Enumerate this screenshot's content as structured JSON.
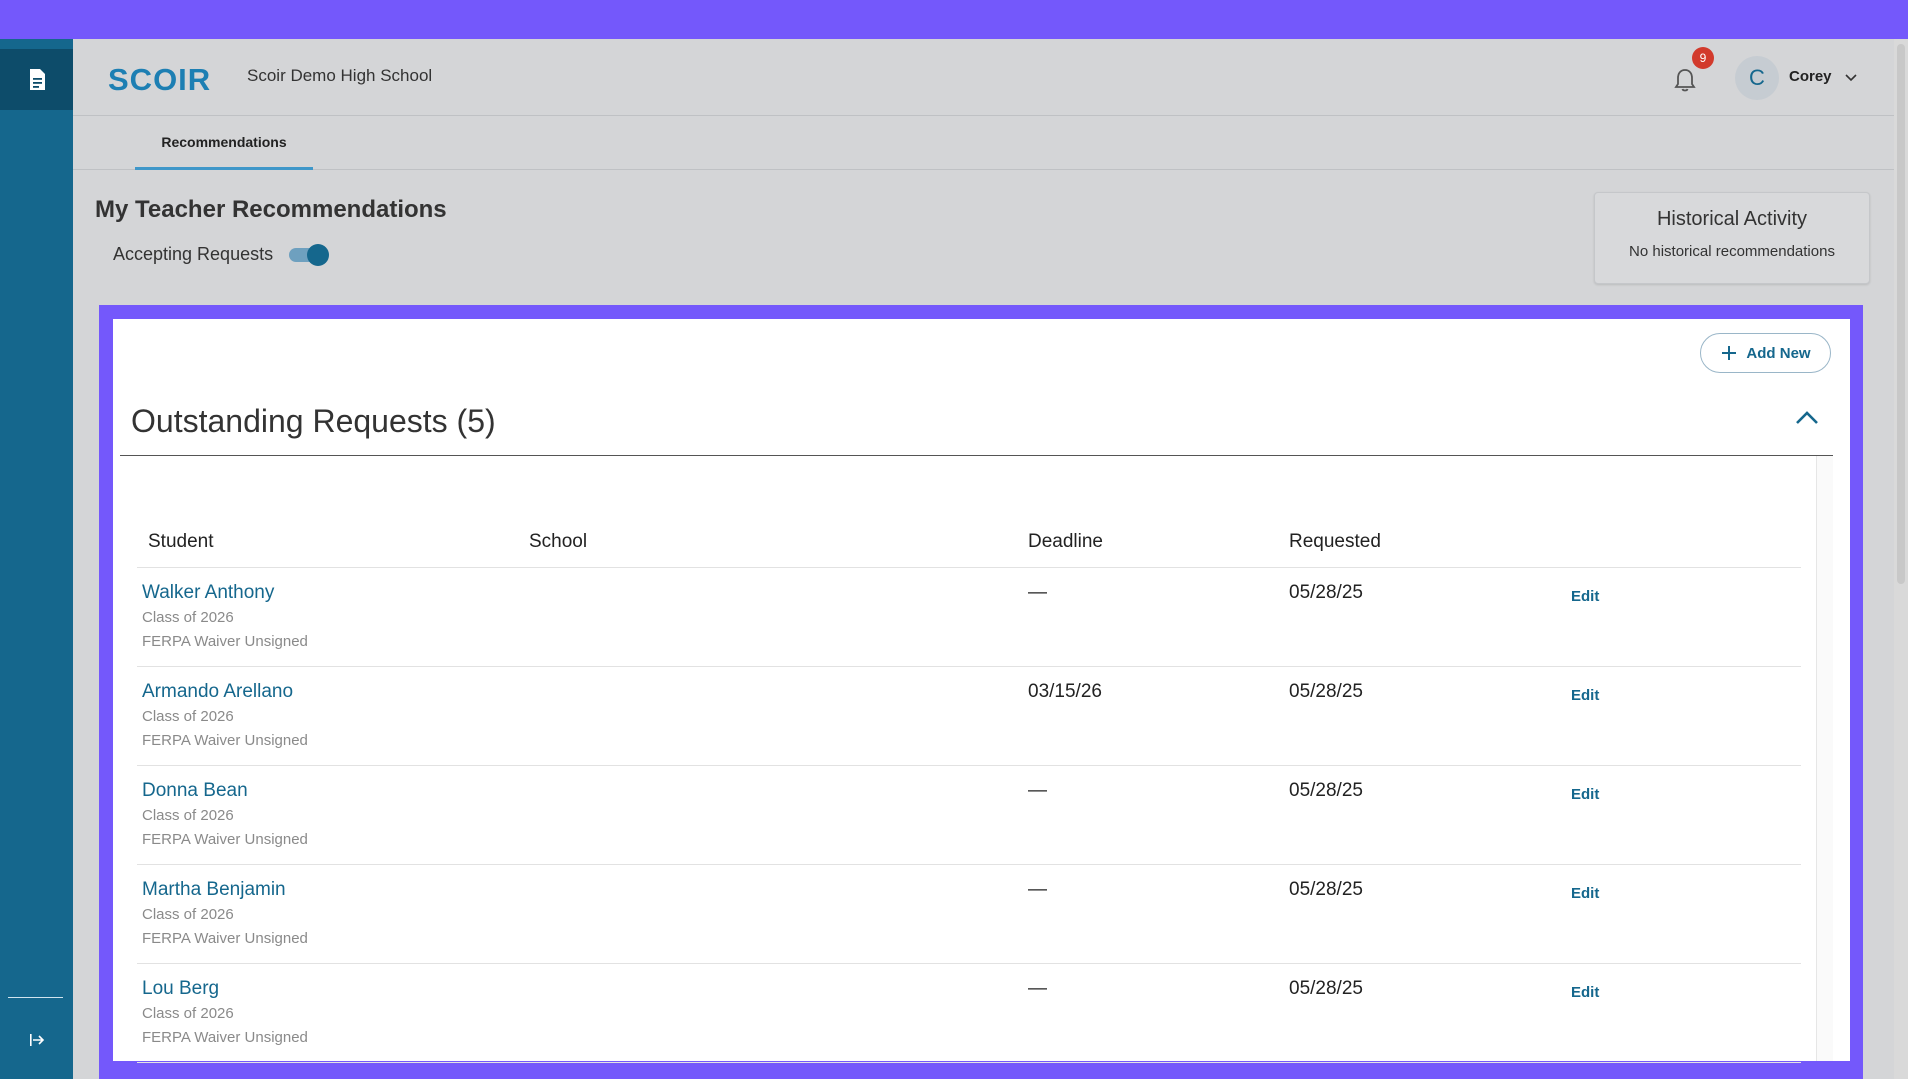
{
  "header": {
    "logo_text": "SCOIR",
    "school_name": "Scoir Demo High School",
    "notification_count": "9",
    "user_initial": "C",
    "user_name": "Corey"
  },
  "tabs": [
    {
      "label": "Recommendations",
      "active": true
    }
  ],
  "page": {
    "title": "My Teacher Recommendations",
    "accepting_label": "Accepting Requests",
    "accepting_on": true
  },
  "historical": {
    "title": "Historical Activity",
    "subtitle": "No historical recommendations"
  },
  "section": {
    "add_new_label": "Add New",
    "title": "Outstanding Requests (5)"
  },
  "table": {
    "headers": {
      "student": "Student",
      "school": "School",
      "deadline": "Deadline",
      "requested": "Requested"
    },
    "rows": [
      {
        "name": "Walker Anthony",
        "class": "Class of 2026",
        "ferpa": "FERPA Waiver Unsigned",
        "school": "",
        "deadline": "—",
        "requested": "05/28/25",
        "action": "Edit"
      },
      {
        "name": "Armando Arellano",
        "class": "Class of 2026",
        "ferpa": "FERPA Waiver Unsigned",
        "school": "",
        "deadline": "03/15/26",
        "requested": "05/28/25",
        "action": "Edit"
      },
      {
        "name": "Donna Bean",
        "class": "Class of 2026",
        "ferpa": "FERPA Waiver Unsigned",
        "school": "",
        "deadline": "—",
        "requested": "05/28/25",
        "action": "Edit"
      },
      {
        "name": "Martha Benjamin",
        "class": "Class of 2026",
        "ferpa": "FERPA Waiver Unsigned",
        "school": "",
        "deadline": "—",
        "requested": "05/28/25",
        "action": "Edit"
      },
      {
        "name": "Lou Berg",
        "class": "Class of 2026",
        "ferpa": "FERPA Waiver Unsigned",
        "school": "",
        "deadline": "—",
        "requested": "05/28/25",
        "action": "Edit"
      }
    ]
  },
  "icons": {
    "rail_top": "document-icon",
    "rail_bottom": "expand-sidebar-icon",
    "bell": "bell-icon",
    "chevron": "chevron-down-icon",
    "collapse": "chevron-up-icon",
    "add": "plus-icon"
  },
  "colors": {
    "brand": "#15678d",
    "accent_overlay": "#7458fb",
    "badge": "#d23a2c"
  }
}
